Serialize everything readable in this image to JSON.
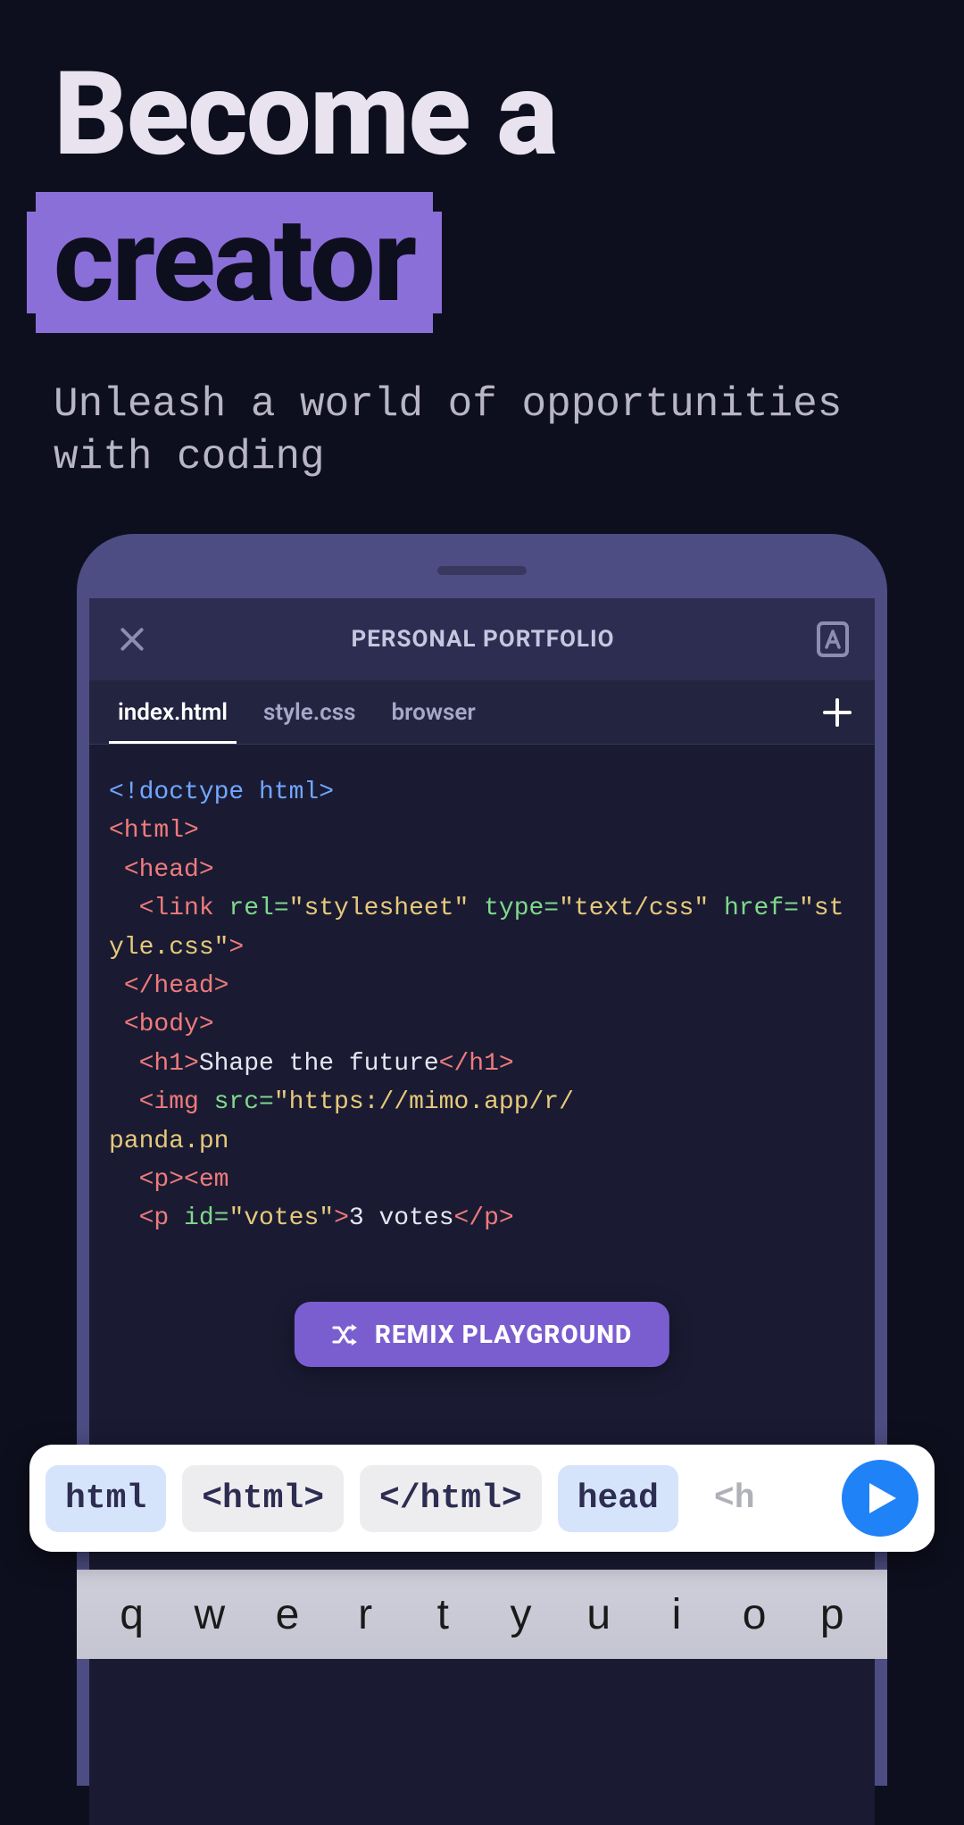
{
  "hero": {
    "line1": "Become a",
    "highlight": "creator",
    "subtitle": "Unleash a world of opportunities with coding"
  },
  "app": {
    "title": "PERSONAL PORTFOLIO",
    "tabs": [
      {
        "label": "index.html",
        "active": true
      },
      {
        "label": "style.css",
        "active": false
      },
      {
        "label": "browser",
        "active": false
      }
    ],
    "code": {
      "doctype": "<!doctype html>",
      "html_open": "<html>",
      "head_open": " <head>",
      "link_open": "  <link",
      "rel_attr": " rel=",
      "rel_val": "\"stylesheet\"",
      "type_attr": " type=",
      "type_val": "\"text/css\"",
      "href_attr": "href=",
      "href_val": "\"style.css\"",
      "link_close": ">",
      "head_close": " </head>",
      "body_open": " <body>",
      "h1_open": "  <h1>",
      "h1_text": "Shape the future",
      "h1_close": "</h1>",
      "img_open": "  <img",
      "src_attr": " src=",
      "src_val1": "\"https://mimo.app/r/",
      "src_val2": "panda.pn",
      "p_open": "  <p>",
      "em_open": "<em",
      "p2_open": "  <p",
      "id_attr": " id=",
      "id_val": "\"votes\"",
      "p2_close": ">",
      "p2_text": "3 votes",
      "p2_end": "</p>"
    },
    "remix_button": "REMIX PLAYGROUND"
  },
  "suggestions": [
    {
      "label": "html",
      "style": "blue"
    },
    {
      "label": "<html>",
      "style": "grey"
    },
    {
      "label": "</html>",
      "style": "grey"
    },
    {
      "label": "head",
      "style": "blue"
    },
    {
      "label": "<h",
      "style": "fade"
    }
  ],
  "keyboard": [
    "q",
    "w",
    "e",
    "r",
    "t",
    "y",
    "u",
    "i",
    "o",
    "p"
  ]
}
